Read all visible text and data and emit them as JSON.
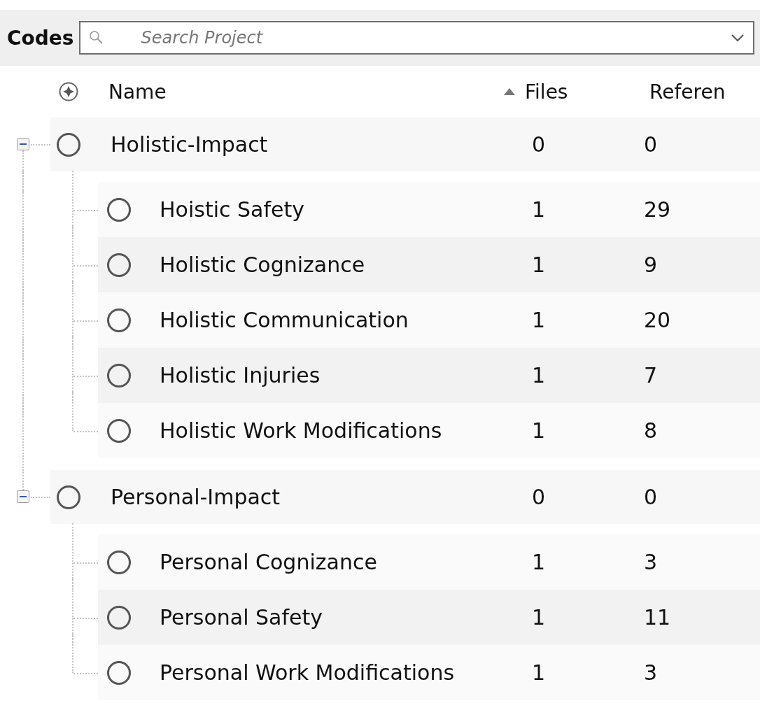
{
  "panel": {
    "title": "Codes",
    "search": {
      "placeholder": "Search Project"
    }
  },
  "columns": [
    {
      "label": "Name",
      "sorted": false
    },
    {
      "label": "Files",
      "sorted": true
    },
    {
      "label": "Referen",
      "sorted": false
    }
  ],
  "tree": [
    {
      "name": "Holistic-Impact",
      "files": "0",
      "references": "0",
      "expanded": true,
      "children": [
        {
          "name": "Hoistic Safety",
          "files": "1",
          "references": "29"
        },
        {
          "name": "Holistic Cognizance",
          "files": "1",
          "references": "9"
        },
        {
          "name": "Holistic Communication",
          "files": "1",
          "references": "20"
        },
        {
          "name": "Holistic Injuries",
          "files": "1",
          "references": "7"
        },
        {
          "name": "Holistic Work Modifications",
          "files": "1",
          "references": "8"
        }
      ]
    },
    {
      "name": "Personal-Impact",
      "files": "0",
      "references": "0",
      "expanded": true,
      "children": [
        {
          "name": "Personal Cognizance",
          "files": "1",
          "references": "3"
        },
        {
          "name": "Personal Safety",
          "files": "1",
          "references": "11"
        },
        {
          "name": "Personal Work Modifications",
          "files": "1",
          "references": "3"
        }
      ]
    }
  ]
}
